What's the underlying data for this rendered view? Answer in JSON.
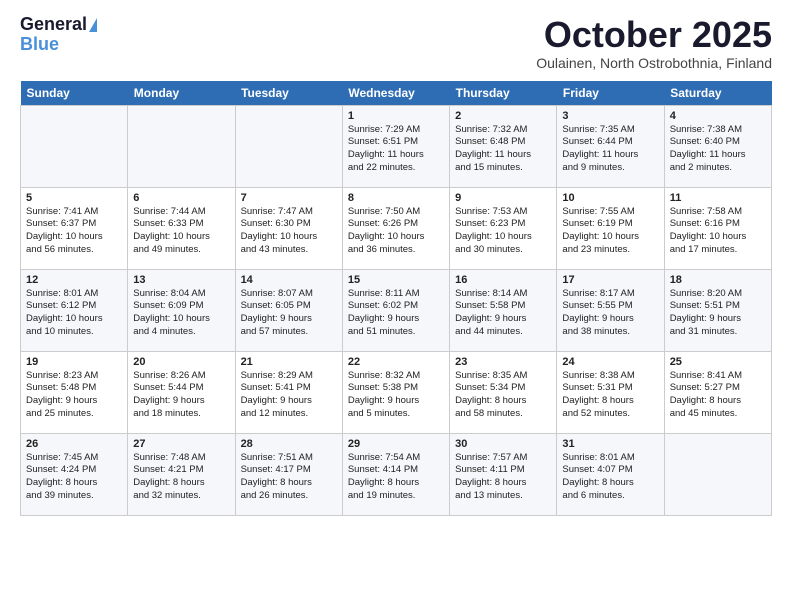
{
  "logo": {
    "line1": "General",
    "line2": "Blue"
  },
  "title": "October 2025",
  "location": "Oulainen, North Ostrobothnia, Finland",
  "headers": [
    "Sunday",
    "Monday",
    "Tuesday",
    "Wednesday",
    "Thursday",
    "Friday",
    "Saturday"
  ],
  "weeks": [
    [
      {
        "day": "",
        "content": ""
      },
      {
        "day": "",
        "content": ""
      },
      {
        "day": "",
        "content": ""
      },
      {
        "day": "1",
        "content": "Sunrise: 7:29 AM\nSunset: 6:51 PM\nDaylight: 11 hours\nand 22 minutes."
      },
      {
        "day": "2",
        "content": "Sunrise: 7:32 AM\nSunset: 6:48 PM\nDaylight: 11 hours\nand 15 minutes."
      },
      {
        "day": "3",
        "content": "Sunrise: 7:35 AM\nSunset: 6:44 PM\nDaylight: 11 hours\nand 9 minutes."
      },
      {
        "day": "4",
        "content": "Sunrise: 7:38 AM\nSunset: 6:40 PM\nDaylight: 11 hours\nand 2 minutes."
      }
    ],
    [
      {
        "day": "5",
        "content": "Sunrise: 7:41 AM\nSunset: 6:37 PM\nDaylight: 10 hours\nand 56 minutes."
      },
      {
        "day": "6",
        "content": "Sunrise: 7:44 AM\nSunset: 6:33 PM\nDaylight: 10 hours\nand 49 minutes."
      },
      {
        "day": "7",
        "content": "Sunrise: 7:47 AM\nSunset: 6:30 PM\nDaylight: 10 hours\nand 43 minutes."
      },
      {
        "day": "8",
        "content": "Sunrise: 7:50 AM\nSunset: 6:26 PM\nDaylight: 10 hours\nand 36 minutes."
      },
      {
        "day": "9",
        "content": "Sunrise: 7:53 AM\nSunset: 6:23 PM\nDaylight: 10 hours\nand 30 minutes."
      },
      {
        "day": "10",
        "content": "Sunrise: 7:55 AM\nSunset: 6:19 PM\nDaylight: 10 hours\nand 23 minutes."
      },
      {
        "day": "11",
        "content": "Sunrise: 7:58 AM\nSunset: 6:16 PM\nDaylight: 10 hours\nand 17 minutes."
      }
    ],
    [
      {
        "day": "12",
        "content": "Sunrise: 8:01 AM\nSunset: 6:12 PM\nDaylight: 10 hours\nand 10 minutes."
      },
      {
        "day": "13",
        "content": "Sunrise: 8:04 AM\nSunset: 6:09 PM\nDaylight: 10 hours\nand 4 minutes."
      },
      {
        "day": "14",
        "content": "Sunrise: 8:07 AM\nSunset: 6:05 PM\nDaylight: 9 hours\nand 57 minutes."
      },
      {
        "day": "15",
        "content": "Sunrise: 8:11 AM\nSunset: 6:02 PM\nDaylight: 9 hours\nand 51 minutes."
      },
      {
        "day": "16",
        "content": "Sunrise: 8:14 AM\nSunset: 5:58 PM\nDaylight: 9 hours\nand 44 minutes."
      },
      {
        "day": "17",
        "content": "Sunrise: 8:17 AM\nSunset: 5:55 PM\nDaylight: 9 hours\nand 38 minutes."
      },
      {
        "day": "18",
        "content": "Sunrise: 8:20 AM\nSunset: 5:51 PM\nDaylight: 9 hours\nand 31 minutes."
      }
    ],
    [
      {
        "day": "19",
        "content": "Sunrise: 8:23 AM\nSunset: 5:48 PM\nDaylight: 9 hours\nand 25 minutes."
      },
      {
        "day": "20",
        "content": "Sunrise: 8:26 AM\nSunset: 5:44 PM\nDaylight: 9 hours\nand 18 minutes."
      },
      {
        "day": "21",
        "content": "Sunrise: 8:29 AM\nSunset: 5:41 PM\nDaylight: 9 hours\nand 12 minutes."
      },
      {
        "day": "22",
        "content": "Sunrise: 8:32 AM\nSunset: 5:38 PM\nDaylight: 9 hours\nand 5 minutes."
      },
      {
        "day": "23",
        "content": "Sunrise: 8:35 AM\nSunset: 5:34 PM\nDaylight: 8 hours\nand 58 minutes."
      },
      {
        "day": "24",
        "content": "Sunrise: 8:38 AM\nSunset: 5:31 PM\nDaylight: 8 hours\nand 52 minutes."
      },
      {
        "day": "25",
        "content": "Sunrise: 8:41 AM\nSunset: 5:27 PM\nDaylight: 8 hours\nand 45 minutes."
      }
    ],
    [
      {
        "day": "26",
        "content": "Sunrise: 7:45 AM\nSunset: 4:24 PM\nDaylight: 8 hours\nand 39 minutes."
      },
      {
        "day": "27",
        "content": "Sunrise: 7:48 AM\nSunset: 4:21 PM\nDaylight: 8 hours\nand 32 minutes."
      },
      {
        "day": "28",
        "content": "Sunrise: 7:51 AM\nSunset: 4:17 PM\nDaylight: 8 hours\nand 26 minutes."
      },
      {
        "day": "29",
        "content": "Sunrise: 7:54 AM\nSunset: 4:14 PM\nDaylight: 8 hours\nand 19 minutes."
      },
      {
        "day": "30",
        "content": "Sunrise: 7:57 AM\nSunset: 4:11 PM\nDaylight: 8 hours\nand 13 minutes."
      },
      {
        "day": "31",
        "content": "Sunrise: 8:01 AM\nSunset: 4:07 PM\nDaylight: 8 hours\nand 6 minutes."
      },
      {
        "day": "",
        "content": ""
      }
    ]
  ]
}
